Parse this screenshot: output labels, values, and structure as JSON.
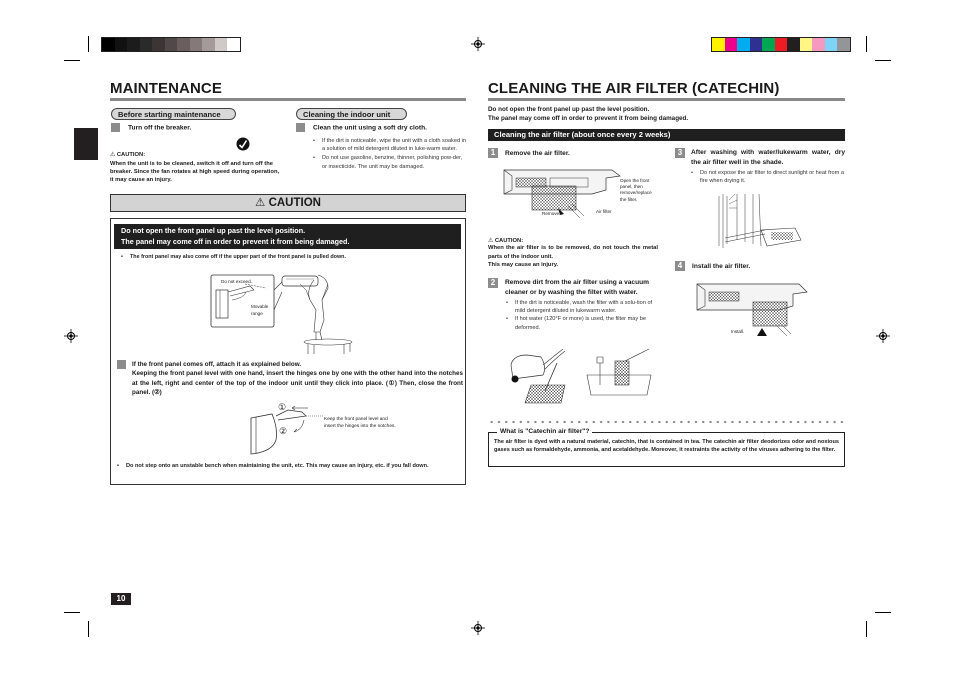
{
  "print_marks": {
    "grayscale_bar": [
      "#000000",
      "#111111",
      "#1c1c1c",
      "#2a2a2a",
      "#3b3535",
      "#514848",
      "#6a5e5e",
      "#857979",
      "#a59a9a",
      "#d1c8c8",
      "#ffffff"
    ],
    "color_bar": [
      "#fff200",
      "#ec008c",
      "#00aeef",
      "#2e3192",
      "#00a651",
      "#ed1c24",
      "#231f20",
      "#fff685",
      "#f49ac1",
      "#7fd3f7",
      "#939598"
    ]
  },
  "left_page": {
    "title": "MAINTENANCE",
    "before": {
      "pill": "Before starting maintenance",
      "step": "Turn off the breaker.",
      "caution_label": "CAUTION:",
      "caution_text": "When the unit is to be cleaned, switch it off and turn off the breaker. Since the fan rotates at high speed during operation, it may cause an injury."
    },
    "indoor": {
      "pill": "Cleaning the indoor unit",
      "step": "Clean the unit using a soft dry cloth.",
      "bullets": [
        "If the dirt is noticeable, wipe the unit with a cloth soaked in a solution of mild detergent diluted in luke-warm water.",
        "Do not use gasoline, benzine, thinner, polishing pow-der, or insecticide. The unit may be damaged."
      ]
    },
    "caution": {
      "heading": "CAUTION",
      "band_line1": "Do not open the front panel up past the level position.",
      "band_line2": "The panel may come off in order to prevent it from being damaged.",
      "bullet1": "The front panel may also come off if the upper part of the front panel is pulled down.",
      "fig1_do_not_exceed": "Do not exceed.",
      "fig1_movable": "Movable",
      "fig1_range": "range",
      "step_line1": "If the front panel comes off, attach it as explained below.",
      "step_body": "Keeping the front panel level with one hand, insert the hinges one by one with the other hand into the notches at the left, right and center of the top of the indoor unit until they click into place. (①) Then, close the front panel. (②)",
      "fig2_n1": "①",
      "fig2_n2": "②",
      "fig2_note1": "Keep the front panel level and",
      "fig2_note2": "insert the hinges into the notches.",
      "bullet2": "Do not step onto an unstable bench when maintaining the unit, etc. This may cause an injury, etc. if you fall down."
    },
    "page_number": "10"
  },
  "right_page": {
    "title": "CLEANING THE AIR FILTER (CATECHIN)",
    "intro_line1": "Do not open the front panel up past the level position.",
    "intro_line2": "The panel may come off in order to prevent it from being damaged.",
    "band": "Cleaning the air filter (about once every 2 weeks)",
    "steps": [
      {
        "num": "1",
        "title": "Remove the air filter."
      },
      {
        "num": "2",
        "title": "Remove dirt from the air filter using a vacuum cleaner or by washing the filter with water."
      },
      {
        "num": "3",
        "title": "After washing with water/lukewarm water, dry the air filter well in the shade."
      },
      {
        "num": "4",
        "title": "Install the air filter."
      }
    ],
    "fig1": {
      "open_note": [
        "Open the front",
        "panel, then",
        "remove/replace",
        "the filter."
      ],
      "remove": "Remove.",
      "air_filter": "Air filter"
    },
    "caution_label": "CAUTION:",
    "caution_text": "When the air filter is to be removed, do not touch the metal parts of the indoor unit.",
    "caution_text2": "This may cause an injury.",
    "step2_bullets": [
      "If the dirt is noticeable, wash the filter with a solu-tion of mild detergent diluted in lukewarm water.",
      "If hot water (120°F or more) is used, the filter may be deformed."
    ],
    "step3_bullets": [
      "Do not expose the air filter to direct sunlight or heat from a fire when drying it."
    ],
    "fig4_install": "Install.",
    "catechin": {
      "title": "What is \"Catechin air filter\"?",
      "text": "The air filter is dyed with a natural material, catechin, that is contained in tea. The catechin air filter deodorizes odor and noxious gases such as formaldehyde, ammonia, and acetaldehyde. Moreover, it restraints the activity of the viruses adhering to the filter."
    }
  }
}
